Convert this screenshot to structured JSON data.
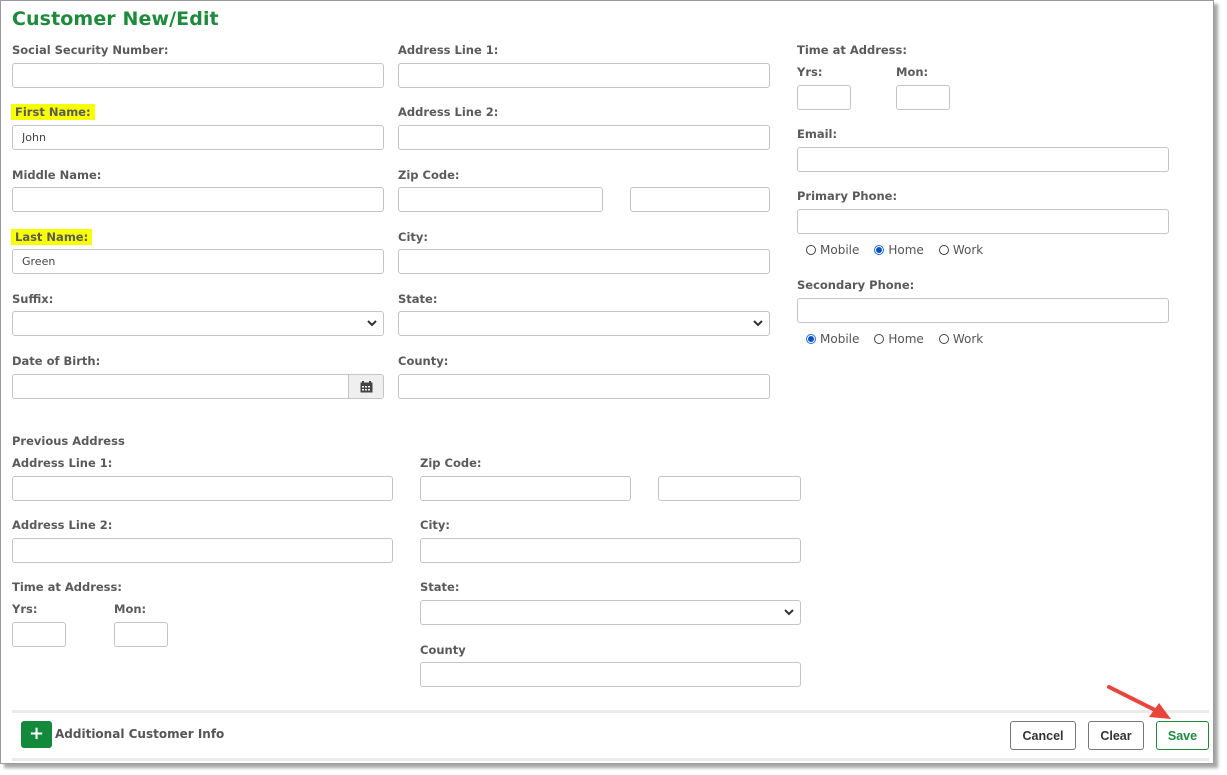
{
  "page": {
    "title": "Customer New/Edit"
  },
  "customer": {
    "ssn": {
      "label": "Social Security Number:",
      "value": ""
    },
    "first_name": {
      "label": "First Name:",
      "value": "John",
      "highlighted": true
    },
    "middle_name": {
      "label": "Middle Name:",
      "value": ""
    },
    "last_name": {
      "label": "Last Name:",
      "value": "Green",
      "highlighted": true
    },
    "suffix": {
      "label": "Suffix:",
      "value": ""
    },
    "dob": {
      "label": "Date of Birth:",
      "value": ""
    }
  },
  "address": {
    "line1": {
      "label": "Address Line 1:",
      "value": ""
    },
    "line2": {
      "label": "Address Line 2:",
      "value": ""
    },
    "zip": {
      "label": "Zip Code:",
      "value": "",
      "ext_value": ""
    },
    "city": {
      "label": "City:",
      "value": ""
    },
    "state": {
      "label": "State:",
      "value": ""
    },
    "county": {
      "label": "County:",
      "value": ""
    }
  },
  "contact": {
    "time_at_address": {
      "label": "Time at Address:",
      "yrs_label": "Yrs:",
      "mon_label": "Mon:",
      "yrs": "",
      "mon": ""
    },
    "email": {
      "label": "Email:",
      "value": ""
    },
    "primary_phone": {
      "label": "Primary Phone:",
      "value": "",
      "types": [
        "Mobile",
        "Home",
        "Work"
      ],
      "selected": "Home"
    },
    "secondary_phone": {
      "label": "Secondary Phone:",
      "value": "",
      "types": [
        "Mobile",
        "Home",
        "Work"
      ],
      "selected": "Mobile"
    }
  },
  "previous_address": {
    "heading": "Previous Address",
    "line1": {
      "label": "Address Line 1:",
      "value": ""
    },
    "line2": {
      "label": "Address Line 2:",
      "value": ""
    },
    "time_at_address": {
      "label": "Time at Address:",
      "yrs_label": "Yrs:",
      "mon_label": "Mon:",
      "yrs": "",
      "mon": ""
    },
    "zip": {
      "label": "Zip Code:",
      "value": "",
      "ext_value": ""
    },
    "city": {
      "label": "City:",
      "value": ""
    },
    "state": {
      "label": "State:",
      "value": ""
    },
    "county": {
      "label": "County",
      "value": ""
    }
  },
  "footer": {
    "additional_info_label": "Additional Customer Info",
    "plus_icon": "+",
    "cancel_label": "Cancel",
    "clear_label": "Clear",
    "save_label": "Save"
  },
  "colors": {
    "brand_green": "#1e8a3c",
    "highlight": "#f7ff00",
    "annotation_arrow": "#e8453c"
  }
}
